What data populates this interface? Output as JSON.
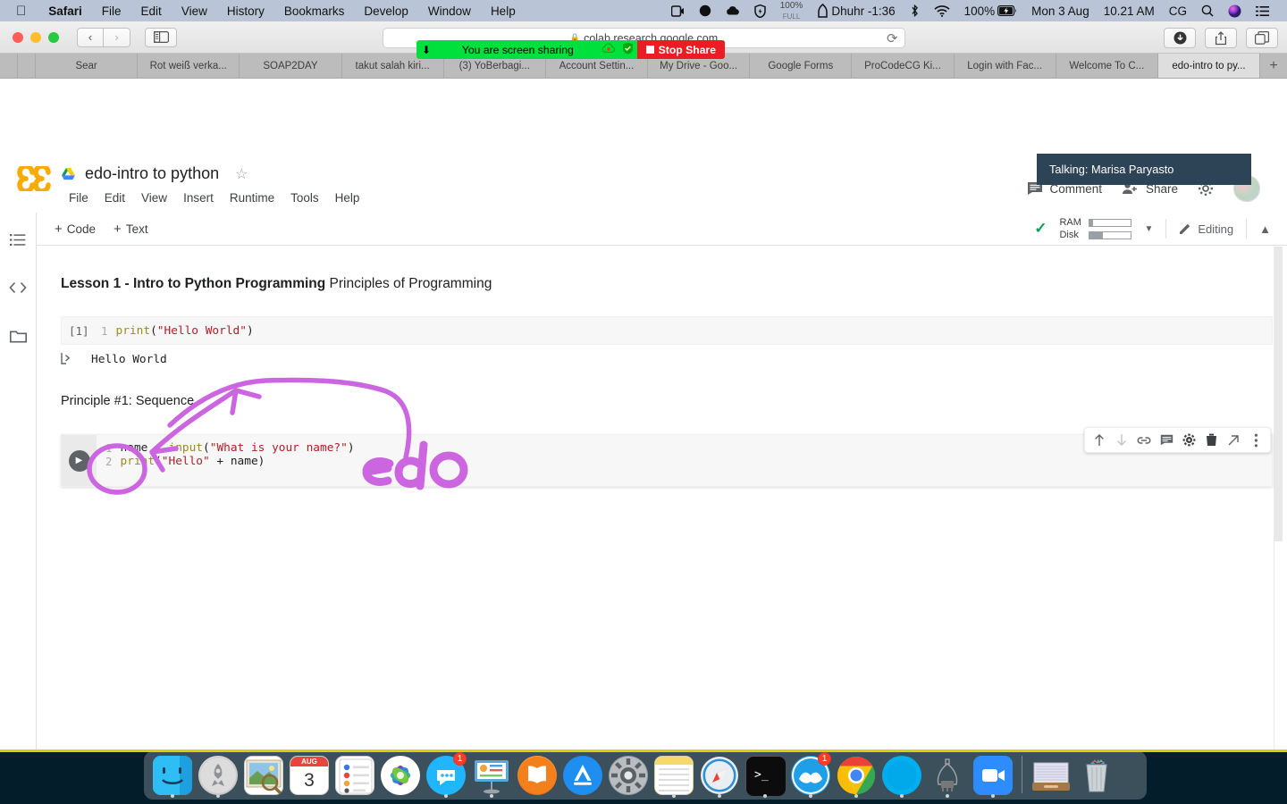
{
  "menubar": {
    "apple_icon": "apple-icon",
    "items": [
      {
        "label": "Safari",
        "bold": true
      },
      {
        "label": "File",
        "bold": false
      },
      {
        "label": "Edit",
        "bold": false
      },
      {
        "label": "View",
        "bold": false
      },
      {
        "label": "History",
        "bold": false
      },
      {
        "label": "Bookmarks",
        "bold": false
      },
      {
        "label": "Develop",
        "bold": false
      },
      {
        "label": "Window",
        "bold": false
      },
      {
        "label": "Help",
        "bold": false
      }
    ],
    "status": {
      "screen_record_icon": "screen-record-icon",
      "dark_circle_icon": "moon-icon",
      "cloud_icon": "cloud-icon",
      "shield_icon": "shield-lock-icon",
      "percent_value": "100%",
      "percent_sub": "FULL",
      "prayer_icon": "prayer-time-icon",
      "prayer_label": "Dhuhr -1:36",
      "bluetooth_icon": "bluetooth-icon",
      "wifi_icon": "wifi-icon",
      "battery_percent": "100%",
      "battery_icon": "battery-charging-icon",
      "date": "Mon 3 Aug",
      "time": "10.21 AM",
      "user": "CG",
      "search_icon": "spotlight-search-icon",
      "siri_icon": "siri-icon",
      "control_center_icon": "control-center-icon"
    }
  },
  "safari": {
    "back_icon": "back-chevron-icon",
    "forward_icon": "forward-chevron-icon",
    "sidebar_icon": "sidebar-toggle-icon",
    "url": "colab.research.google.com",
    "lock_icon": "lock-icon",
    "reload_icon": "reload-icon",
    "downloads_icon": "downloads-icon",
    "share_icon": "share-icon",
    "tabs_overview_icon": "tab-overview-icon",
    "screen_share_banner": {
      "bolt_icon": "bolt-icon",
      "text": "You are screen sharing",
      "cloud_icon": "cloud-record-icon",
      "shield_icon": "shield-icon",
      "stop_label": "Stop Share"
    },
    "tabs": [
      {
        "label": "",
        "narrow": true,
        "active": false
      },
      {
        "label": "",
        "narrow": true,
        "active": false
      },
      {
        "label": "Sear",
        "narrow": false,
        "active": false
      },
      {
        "label": "Rot weiß verka...",
        "narrow": false,
        "active": false
      },
      {
        "label": "SOAP2DAY",
        "narrow": false,
        "active": false
      },
      {
        "label": "takut salah kiri...",
        "narrow": false,
        "active": false
      },
      {
        "label": "(3) YoBerbagi...",
        "narrow": false,
        "active": false
      },
      {
        "label": "Account Settin...",
        "narrow": false,
        "active": false
      },
      {
        "label": "My Drive - Goo...",
        "narrow": false,
        "active": false
      },
      {
        "label": "Google Forms",
        "narrow": false,
        "active": false
      },
      {
        "label": "ProCodeCG Ki...",
        "narrow": false,
        "active": false
      },
      {
        "label": "Login with Fac...",
        "narrow": false,
        "active": false
      },
      {
        "label": "Welcome To C...",
        "narrow": false,
        "active": false
      },
      {
        "label": "edo-intro to py...",
        "narrow": false,
        "active": true
      }
    ],
    "new_tab_label": "+"
  },
  "colab": {
    "logo_icon": "colab-logo-icon",
    "drive_icon": "google-drive-icon",
    "notebook_title": "edo-intro to python",
    "star_icon": "star-outline-icon",
    "menu": [
      "File",
      "Edit",
      "View",
      "Insert",
      "Runtime",
      "Tools",
      "Help"
    ],
    "header_right": {
      "comment_icon": "comment-icon",
      "comment_label": "Comment",
      "share_icon": "share-person-icon",
      "share_label": "Share",
      "settings_icon": "gear-icon",
      "avatar": "user-avatar"
    },
    "talking_tooltip": "Talking: Marisa Paryasto",
    "toolbar": {
      "add_code_label": "Code",
      "add_text_label": "Text",
      "plus_icon": "plus-icon",
      "connected_icon": "checkmark-icon",
      "ram_label": "RAM",
      "disk_label": "Disk",
      "ram_fill_pct": 8,
      "disk_fill_pct": 32,
      "caret_down_icon": "chevron-down-icon",
      "editing_label": "Editing",
      "pencil_icon": "pencil-icon",
      "collapse_icon": "chevron-up-icon"
    },
    "rail": [
      {
        "icon": "table-of-contents-icon",
        "name": "sidebar-item-toc"
      },
      {
        "icon": "code-snippets-icon",
        "name": "sidebar-item-snippets"
      },
      {
        "icon": "files-folder-icon",
        "name": "sidebar-item-files"
      }
    ],
    "notebook": {
      "heading_bold": "Lesson 1 - Intro to Python Programming",
      "heading_rest": " Principles of Programming",
      "cell1": {
        "exec_count": "[1]",
        "line_no": "1",
        "code_fn": "print",
        "code_paren_open": "(",
        "code_str": "\"Hello World\"",
        "code_paren_close": ")",
        "output_icon": "output-arrow-icon",
        "output_text": "Hello World"
      },
      "principle_text": "Principle #1: Sequence",
      "cell2": {
        "run_icon": "run-play-icon",
        "line1_no": "1",
        "line1_var": "name",
        "line1_eq": " = ",
        "line1_fn": "input",
        "line1_open": "(",
        "line1_str": "\"What is your name?\"",
        "line1_close": ")",
        "line2_no": "2",
        "line2_fn": "print",
        "line2_open": "(",
        "line2_str": "\"Hello\"",
        "line2_plus": " + ",
        "line2_var": "name",
        "line2_close": ")"
      },
      "cell_tools": [
        {
          "icon": "move-cell-up-icon",
          "dim": false
        },
        {
          "icon": "move-cell-down-icon",
          "dim": true
        },
        {
          "icon": "link-icon",
          "dim": false
        },
        {
          "icon": "add-comment-icon",
          "dim": false
        },
        {
          "icon": "cell-settings-gear-icon",
          "dim": false
        },
        {
          "icon": "delete-cell-trash-icon",
          "dim": false
        },
        {
          "icon": "open-in-new-tab-icon",
          "dim": false
        },
        {
          "icon": "more-vertical-icon",
          "dim": false
        }
      ],
      "annotations": {
        "color": "#cc66e0",
        "handwritten_text": "edo",
        "circle_target": "name",
        "arrow": "curved-arrow-pointing-to-name"
      }
    }
  },
  "dock": {
    "apps": [
      {
        "name": "finder",
        "label": "Finder",
        "running": true,
        "badge": null
      },
      {
        "name": "launchpad",
        "label": "Launchpad",
        "running": true,
        "badge": null
      },
      {
        "name": "preview",
        "label": "Preview",
        "running": false,
        "badge": null
      },
      {
        "name": "calendar",
        "label": "Calendar",
        "running": false,
        "badge": null,
        "month": "AUG",
        "day": "3"
      },
      {
        "name": "reminders",
        "label": "Reminders",
        "running": false,
        "badge": null
      },
      {
        "name": "photos",
        "label": "Photos",
        "running": false,
        "badge": null
      },
      {
        "name": "messages",
        "label": "Messages",
        "running": true,
        "badge": "1"
      },
      {
        "name": "keynote",
        "label": "Keynote",
        "running": true,
        "badge": null
      },
      {
        "name": "books",
        "label": "Books",
        "running": false,
        "badge": null
      },
      {
        "name": "app-store",
        "label": "App Store",
        "running": false,
        "badge": null
      },
      {
        "name": "system-preferences",
        "label": "System Preferences",
        "running": false,
        "badge": null
      },
      {
        "name": "notes",
        "label": "Notes",
        "running": true,
        "badge": null
      },
      {
        "name": "safari",
        "label": "Safari",
        "running": true,
        "badge": null
      },
      {
        "name": "terminal",
        "label": "Terminal",
        "running": true,
        "badge": null
      },
      {
        "name": "pocketbook",
        "label": "Cloud App",
        "running": true,
        "badge": "1"
      },
      {
        "name": "chrome",
        "label": "Google Chrome",
        "running": true,
        "badge": null
      },
      {
        "name": "skype",
        "label": "Skype",
        "running": true,
        "badge": null
      },
      {
        "name": "fritzing",
        "label": "Fritzing",
        "running": true,
        "badge": null
      },
      {
        "name": "zoom",
        "label": "Zoom",
        "running": true,
        "badge": null
      }
    ],
    "stack_name": "documents-stack",
    "trash_name": "trash"
  }
}
